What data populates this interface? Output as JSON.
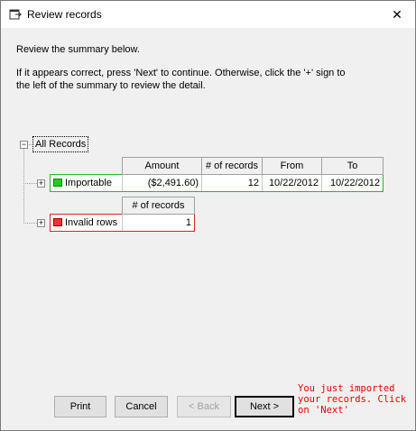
{
  "window": {
    "title": "Review records",
    "close_glyph": "✕"
  },
  "instructions": {
    "line1": "Review the summary below.",
    "line2": "If it appears correct, press 'Next' to continue.  Otherwise, click the '+' sign to",
    "line3": "the left of the summary to review the detail."
  },
  "tree": {
    "root_label": "All Records",
    "collapse_glyph": "−",
    "expand_glyph": "+"
  },
  "importable": {
    "headers": [
      "Amount",
      "# of records",
      "From",
      "To"
    ],
    "label": "Importable",
    "amount": "($2,491.60)",
    "records": "12",
    "from": "10/22/2012",
    "to": "10/22/2012",
    "status_color": "#22cc22"
  },
  "invalid": {
    "header": "# of records",
    "label": "Invalid rows",
    "records": "1",
    "status_color": "#ee3333"
  },
  "buttons": {
    "print": "Print",
    "cancel": "Cancel",
    "back": "< Back",
    "next": "Next >"
  },
  "hint_text": "You just imported your records. Click on 'Next'"
}
